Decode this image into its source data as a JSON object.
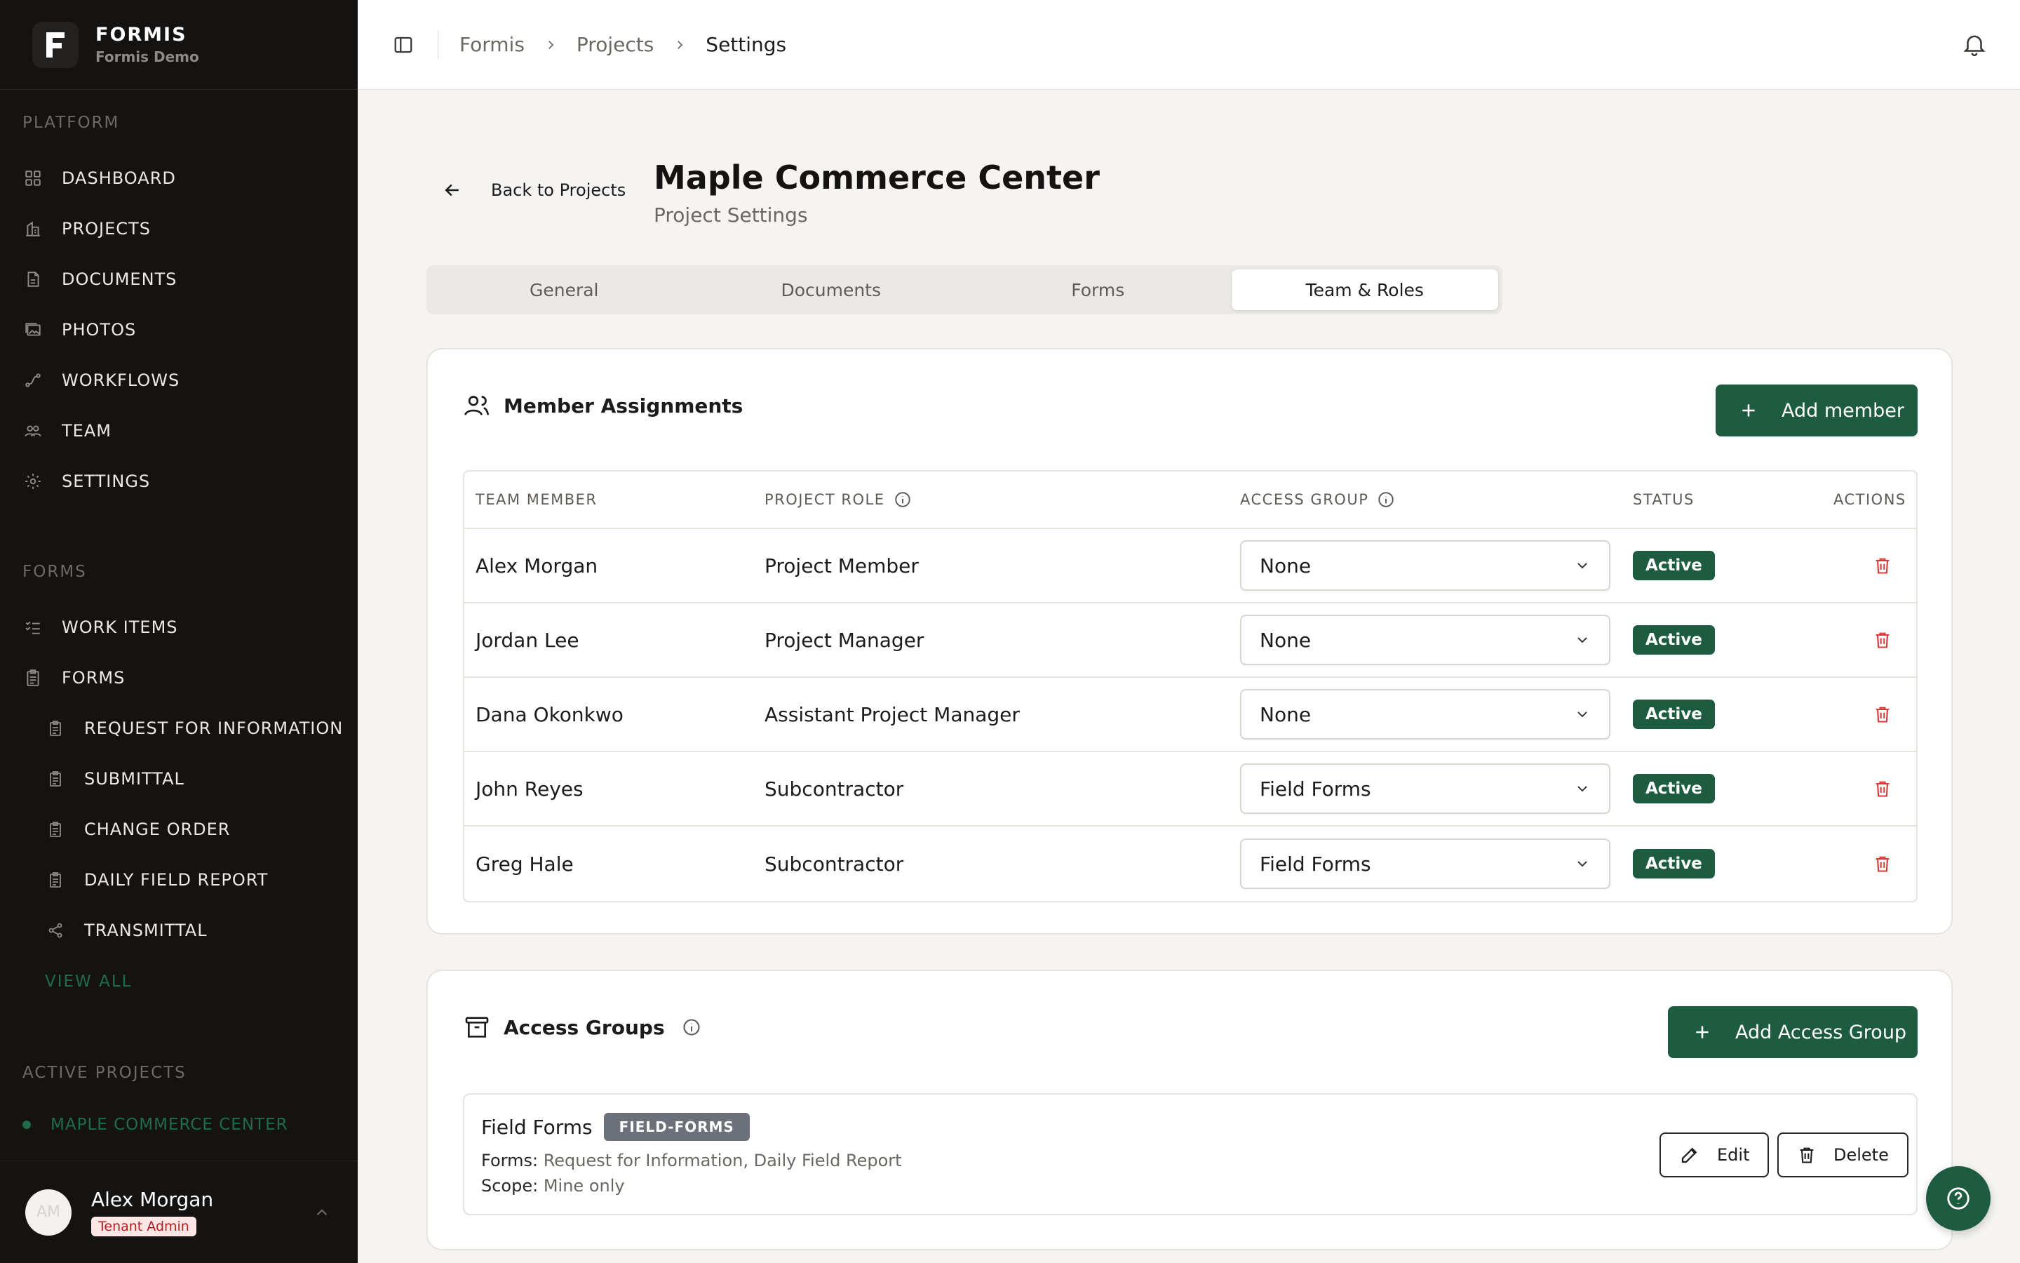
{
  "brand": {
    "name": "FORMIS",
    "sub": "Formis Demo",
    "logo_letter": "F"
  },
  "sidebar": {
    "platform_label": "PLATFORM",
    "platform_items": [
      {
        "label": "DASHBOARD",
        "icon": "grid-icon"
      },
      {
        "label": "PROJECTS",
        "icon": "building-icon"
      },
      {
        "label": "DOCUMENTS",
        "icon": "document-icon"
      },
      {
        "label": "PHOTOS",
        "icon": "photos-icon"
      },
      {
        "label": "WORKFLOWS",
        "icon": "workflow-icon"
      },
      {
        "label": "TEAM",
        "icon": "team-icon"
      },
      {
        "label": "SETTINGS",
        "icon": "gear-icon"
      }
    ],
    "forms_label": "FORMS",
    "forms_items": [
      {
        "label": "WORK ITEMS",
        "icon": "list-check-icon"
      },
      {
        "label": "FORMS",
        "icon": "clipboard-icon"
      }
    ],
    "forms_sub_items": [
      {
        "label": "REQUEST FOR INFORMATION",
        "icon": "form-icon"
      },
      {
        "label": "SUBMITTAL",
        "icon": "form-icon"
      },
      {
        "label": "CHANGE ORDER",
        "icon": "form-icon"
      },
      {
        "label": "DAILY FIELD REPORT",
        "icon": "form-icon"
      },
      {
        "label": "TRANSMITTAL",
        "icon": "share-icon"
      }
    ],
    "view_all": "VIEW ALL",
    "active_projects_label": "ACTIVE PROJECTS",
    "active_project": "MAPLE COMMERCE CENTER",
    "user": {
      "initials": "AM",
      "name": "Alex Morgan",
      "role": "Tenant Admin"
    }
  },
  "topbar": {
    "breadcrumbs": [
      "Formis",
      "Projects",
      "Settings"
    ]
  },
  "header": {
    "back_label": "Back to Projects",
    "title": "Maple Commerce Center",
    "subtitle": "Project Settings"
  },
  "tabs": [
    {
      "label": "General",
      "active": false
    },
    {
      "label": "Documents",
      "active": false
    },
    {
      "label": "Forms",
      "active": false
    },
    {
      "label": "Team & Roles",
      "active": true
    }
  ],
  "members": {
    "title": "Member Assignments",
    "add_label": "Add member",
    "columns": [
      "TEAM MEMBER",
      "PROJECT ROLE",
      "ACCESS GROUP",
      "STATUS",
      "ACTIONS"
    ],
    "rows": [
      {
        "name": "Alex Morgan",
        "role": "Project Member",
        "group": "None",
        "status": "Active"
      },
      {
        "name": "Jordan Lee",
        "role": "Project Manager",
        "group": "None",
        "status": "Active"
      },
      {
        "name": "Dana Okonkwo",
        "role": "Assistant Project Manager",
        "group": "None",
        "status": "Active"
      },
      {
        "name": "John Reyes",
        "role": "Subcontractor",
        "group": "Field Forms",
        "status": "Active"
      },
      {
        "name": "Greg Hale",
        "role": "Subcontractor",
        "group": "Field Forms",
        "status": "Active"
      }
    ]
  },
  "access_groups": {
    "title": "Access Groups",
    "add_label": "Add Access Group",
    "groups": [
      {
        "name": "Field Forms",
        "tag": "FIELD-FORMS",
        "forms_key": "Forms:",
        "forms_value": "Request for Information, Daily Field Report",
        "scope_key": "Scope:",
        "scope_value": "Mine only",
        "edit_label": "Edit",
        "delete_label": "Delete"
      }
    ]
  },
  "colors": {
    "sidebar_bg": "#151212",
    "accent": "#1d5c40",
    "danger": "#d83a3a"
  }
}
